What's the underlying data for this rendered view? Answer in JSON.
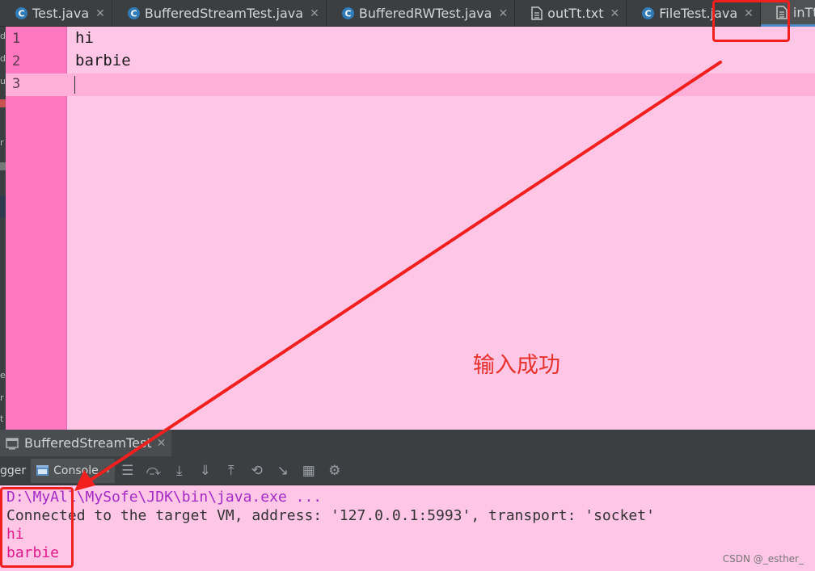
{
  "tabs": [
    {
      "label": "Test.java",
      "icon": "java-class-icon",
      "active": false
    },
    {
      "label": "BufferedStreamTest.java",
      "icon": "java-class-icon",
      "active": false
    },
    {
      "label": "BufferedRWTest.java",
      "icon": "java-class-icon",
      "active": false
    },
    {
      "label": "outTt.txt",
      "icon": "text-file-icon",
      "active": false
    },
    {
      "label": "FileTest.java",
      "icon": "java-class-icon",
      "active": false
    },
    {
      "label": "inTt.txt",
      "icon": "text-file-icon",
      "active": true
    }
  ],
  "editor": {
    "line_numbers": [
      "1",
      "2",
      "3"
    ],
    "lines": [
      "hi",
      "barbie",
      ""
    ]
  },
  "annotation": {
    "text": "输入成功",
    "color": "#e8312a"
  },
  "run_panel": {
    "tab_label": "BufferedStreamTest",
    "debugger_label": "gger",
    "console_label": "Console",
    "console_lines": [
      {
        "text": "D:\\MyAll\\MySofe\\JDK\\bin\\java.exe ...",
        "kind": "command"
      },
      {
        "text": "Connected to the target VM, address: '127.0.0.1:5993', transport: 'socket'",
        "kind": "info"
      },
      {
        "text": "hi",
        "kind": "output"
      },
      {
        "text": "barbie",
        "kind": "output"
      }
    ]
  },
  "watermark": "CSDN @_esther_",
  "colors": {
    "editor_bg": "#ffc6e6",
    "gutter_bg": "#ff78c0",
    "highlight_red": "#f21f1f",
    "ide_dark": "#3c3f41"
  }
}
